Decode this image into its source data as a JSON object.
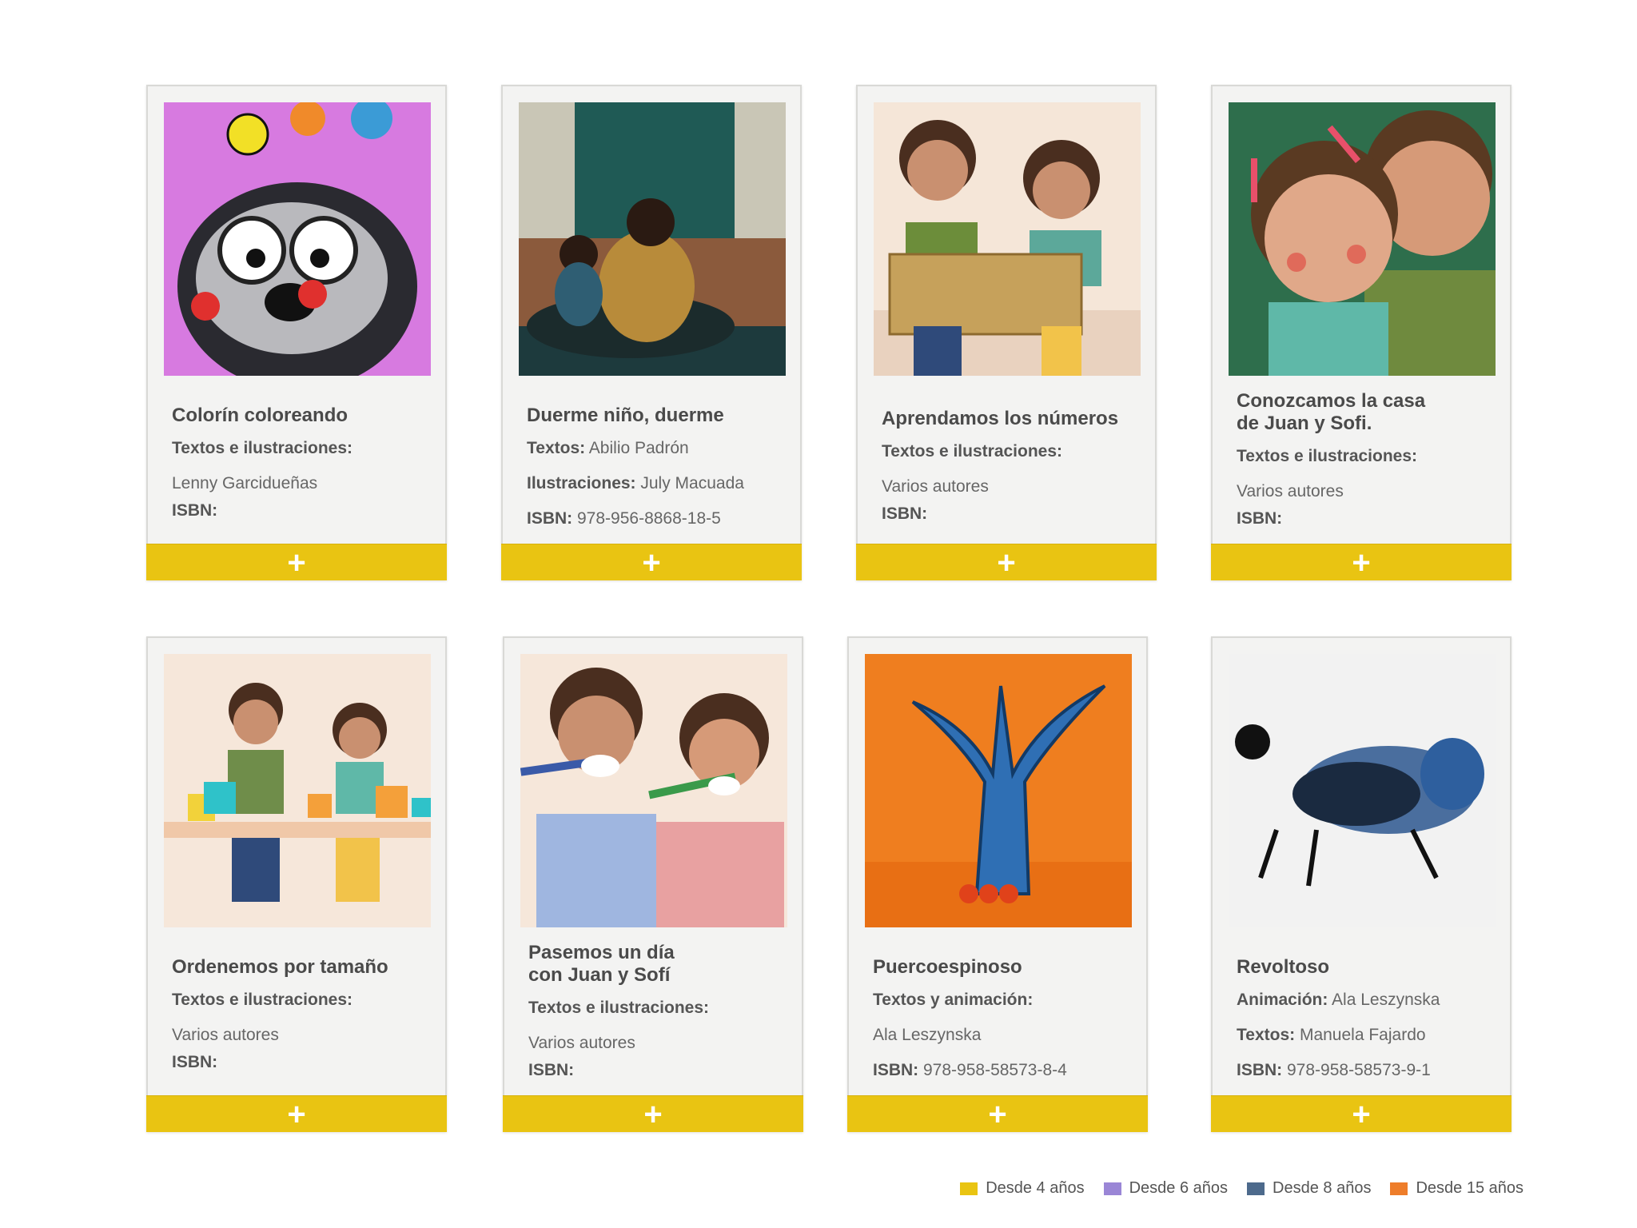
{
  "books": [
    {
      "title": "Colorín coloreando",
      "lines": [
        {
          "label": "Textos e ilustraciones:",
          "value": ""
        },
        {
          "label": "",
          "value": "Lenny Garcidueñas"
        },
        {
          "label": "ISBN:",
          "value": ""
        }
      ],
      "plus": "+"
    },
    {
      "title": "Duerme niño, duerme",
      "lines": [
        {
          "label": "Textos:",
          "value": " Abilio Padrón"
        },
        {
          "label": "Ilustraciones:",
          "value": " July Macuada"
        },
        {
          "label": "ISBN:",
          "value": " 978-956-8868-18-5"
        }
      ],
      "plus": "+"
    },
    {
      "title": "Aprendamos los números",
      "lines": [
        {
          "label": "Textos e ilustraciones:",
          "value": ""
        },
        {
          "label": "",
          "value": "Varios autores"
        },
        {
          "label": "ISBN:",
          "value": ""
        }
      ],
      "plus": "+"
    },
    {
      "title_line1": "Conozcamos la casa",
      "title_line2": "de Juan y Sofi.",
      "lines": [
        {
          "label": "Textos e ilustraciones:",
          "value": ""
        },
        {
          "label": "",
          "value": "Varios autores"
        },
        {
          "label": "ISBN:",
          "value": ""
        }
      ],
      "plus": "+"
    },
    {
      "title": "Ordenemos por tamaño",
      "lines": [
        {
          "label": "Textos e ilustraciones:",
          "value": ""
        },
        {
          "label": "",
          "value": "Varios autores"
        },
        {
          "label": "ISBN:",
          "value": ""
        }
      ],
      "plus": "+"
    },
    {
      "title_line1": "Pasemos un día",
      "title_line2": "con Juan y Sofí",
      "lines": [
        {
          "label": "Textos e ilustraciones:",
          "value": ""
        },
        {
          "label": "",
          "value": "Varios autores"
        },
        {
          "label": "ISBN:",
          "value": ""
        }
      ],
      "plus": "+"
    },
    {
      "title": "Puercoespinoso",
      "lines": [
        {
          "label": "Textos y animación:",
          "value": ""
        },
        {
          "label": "",
          "value": "Ala Leszynska"
        },
        {
          "label": "ISBN:",
          "value": " 978-958-58573-8-4"
        }
      ],
      "plus": "+"
    },
    {
      "title": "Revoltoso",
      "lines": [
        {
          "label": "Animación:",
          "value": " Ala Leszynska"
        },
        {
          "label": "Textos:",
          "value": " Manuela Fajardo"
        },
        {
          "label": "ISBN:",
          "value": " 978-958-58573-9-1"
        }
      ],
      "plus": "+"
    }
  ],
  "legend": [
    {
      "label": "Desde 4 años",
      "color": "#e9c412"
    },
    {
      "label": "Desde 6 años",
      "color": "#9a86d6"
    },
    {
      "label": "Desde 8 años",
      "color": "#4d6a8c"
    },
    {
      "label": "Desde 15 años",
      "color": "#ee7d2a"
    }
  ],
  "colors": {
    "accent": "#e9c412",
    "card_bg": "#f3f3f2"
  }
}
